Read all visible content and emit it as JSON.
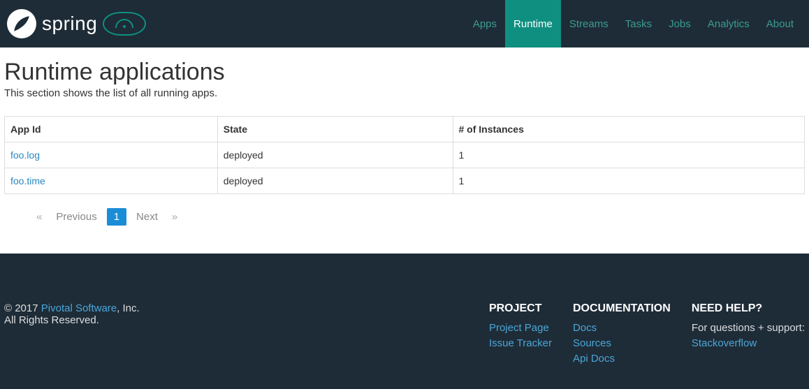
{
  "brand": {
    "text": "spring"
  },
  "nav": {
    "items": [
      {
        "label": "Apps",
        "active": false
      },
      {
        "label": "Runtime",
        "active": true
      },
      {
        "label": "Streams",
        "active": false
      },
      {
        "label": "Tasks",
        "active": false
      },
      {
        "label": "Jobs",
        "active": false
      },
      {
        "label": "Analytics",
        "active": false
      },
      {
        "label": "About",
        "active": false
      }
    ]
  },
  "page": {
    "title": "Runtime applications",
    "subtitle": "This section shows the list of all running apps."
  },
  "table": {
    "headers": {
      "id": "App Id",
      "state": "State",
      "instances": "# of Instances"
    },
    "rows": [
      {
        "id": "foo.log",
        "state": "deployed",
        "instances": "1"
      },
      {
        "id": "foo.time",
        "state": "deployed",
        "instances": "1"
      }
    ]
  },
  "pagination": {
    "prev_glyph": "«",
    "prev": "Previous",
    "current": "1",
    "next": "Next",
    "next_glyph": "»"
  },
  "footer": {
    "copy_prefix": "© 2017 ",
    "copy_link": "Pivotal Software",
    "copy_suffix": ", Inc.",
    "rights": "All Rights Reserved.",
    "project": {
      "heading": "PROJECT",
      "links": [
        "Project Page",
        "Issue Tracker"
      ]
    },
    "documentation": {
      "heading": "DOCUMENTATION",
      "links": [
        "Docs",
        "Sources",
        "Api Docs"
      ]
    },
    "help": {
      "heading": "NEED HELP?",
      "text": "For questions + support:",
      "links": [
        "Stackoverflow"
      ]
    }
  }
}
